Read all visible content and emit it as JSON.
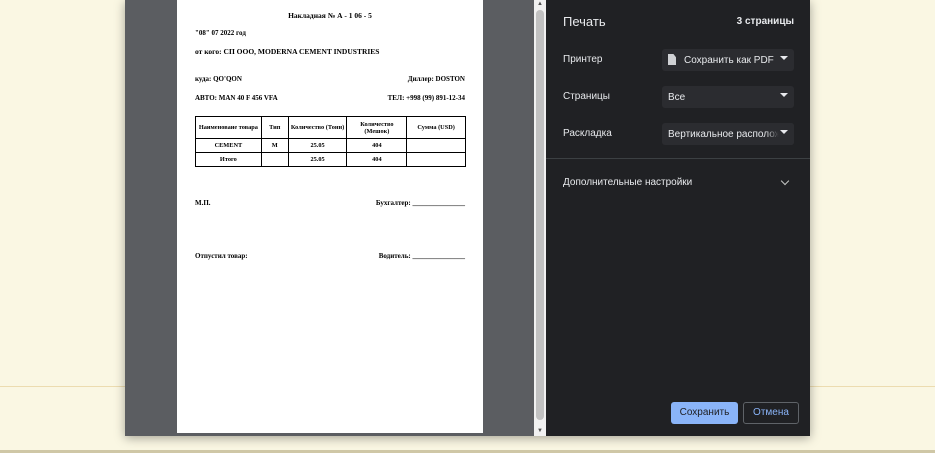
{
  "document": {
    "title": "Накладная № А - 1 06 - 5",
    "date": "\"08\" 07 2022 год",
    "from": "от кого: СП ООО, MODERNA CEMENT INDUSTRIES",
    "where": "куда: QO'QON",
    "dealer": "Диллер: DOSTON",
    "auto": "АВТО: MAN 40 F 456 VFA",
    "tel": "ТЕЛ: +998 (99) 891-12-34",
    "table": {
      "headers": [
        "Наименоваие товара",
        "Тип",
        "Количество (Тонн)",
        "Количество (Мешок)",
        "Сумма (USD)"
      ],
      "rows": [
        [
          "CEMENT",
          "M",
          "25.05",
          "404",
          ""
        ],
        [
          "Итого",
          "",
          "25.05",
          "404",
          ""
        ]
      ]
    },
    "mp": "М.П.",
    "accountant": "Бухгалтер: _______________",
    "released": "Отпустил товар:",
    "driver": "Водитель: _______________"
  },
  "panel": {
    "title": "Печать",
    "page_count": "3 страницы",
    "printer": {
      "label": "Принтер",
      "value": "Сохранить как PDF"
    },
    "pages": {
      "label": "Страницы",
      "value": "Все"
    },
    "layout": {
      "label": "Раскладка",
      "value": "Вертикальное расположение"
    },
    "more_settings": "Дополнительные настройки",
    "save_button": "Сохранить",
    "cancel_button": "Отмена"
  },
  "colors": {
    "panel_bg": "#202124",
    "accent": "#8ab4f8",
    "preview_bg": "#5b5d61"
  },
  "icons": {
    "printer": "pdf-file-icon",
    "dropdown": "chevron-down-icon",
    "scroll_up": "scroll-up-arrow-icon",
    "scroll_down": "scroll-down-arrow-icon"
  }
}
